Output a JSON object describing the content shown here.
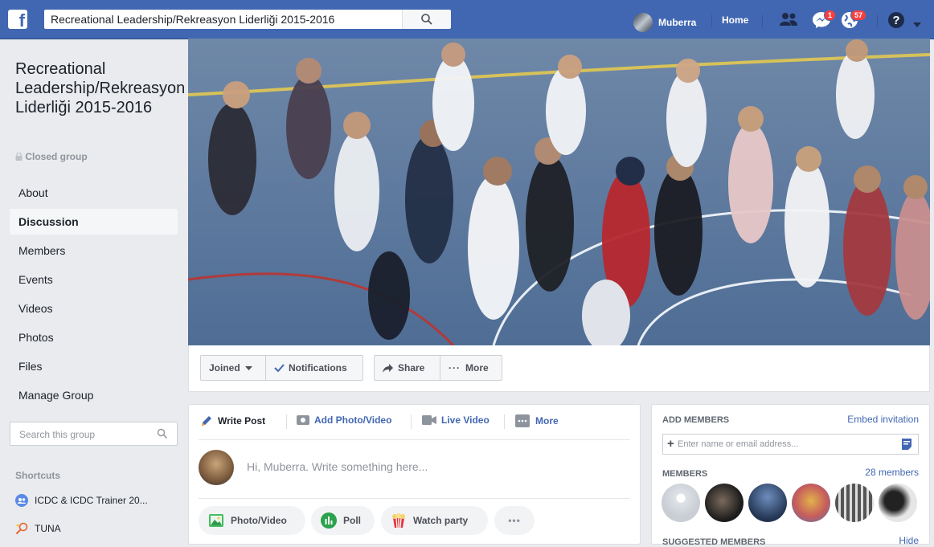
{
  "topbar": {
    "logo": "f",
    "search_text": "Recreational Leadership/Rekreasyon Liderliği 2015-2016",
    "user_name": "Muberra",
    "home_label": "Home",
    "messages_badge": "1",
    "notifications_badge": "57"
  },
  "group": {
    "title": "Recreational Leadership/Rekreasyon Liderliği 2015-2016",
    "privacy": "Closed group"
  },
  "nav": {
    "items": [
      "About",
      "Discussion",
      "Members",
      "Events",
      "Videos",
      "Photos",
      "Files",
      "Manage Group"
    ],
    "active": "Discussion"
  },
  "search_group": {
    "placeholder": "Search this group"
  },
  "shortcuts": {
    "heading": "Shortcuts",
    "items": [
      "ICDC & ICDC Trainer 20...",
      "TUNA"
    ]
  },
  "actions": {
    "joined": "Joined",
    "notifications": "Notifications",
    "share": "Share",
    "more": "More"
  },
  "composer": {
    "tabs": [
      "Write Post",
      "Add Photo/Video",
      "Live Video",
      "More"
    ],
    "prompt": "Hi, Muberra. Write something here...",
    "pills": [
      "Photo/Video",
      "Poll",
      "Watch party"
    ]
  },
  "right_panel": {
    "add_members_heading": "ADD MEMBERS",
    "embed_link": "Embed invitation",
    "input_placeholder": "Enter name or email address...",
    "members_heading": "MEMBERS",
    "members_count": "28 members",
    "suggested_heading": "SUGGESTED MEMBERS",
    "hide_link": "Hide"
  },
  "colors": {
    "brand": "#4267b2",
    "badge": "#fa3e3e",
    "background": "#e9ebee"
  }
}
